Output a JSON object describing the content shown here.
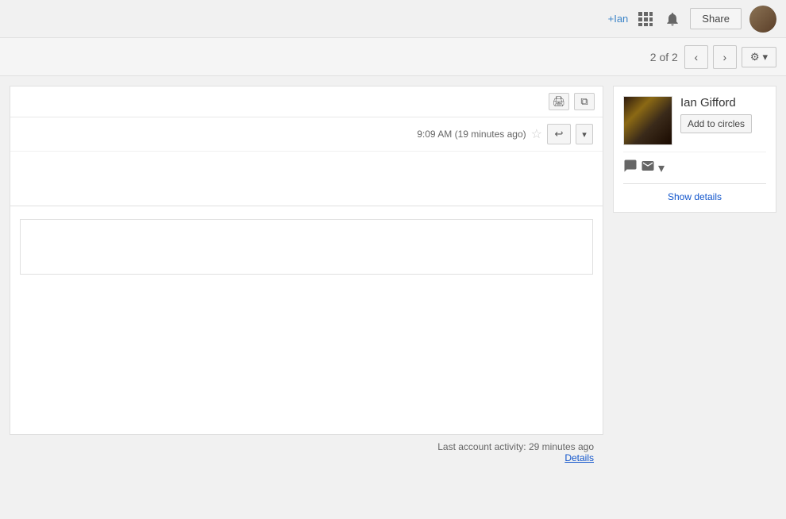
{
  "topnav": {
    "plus_ian_label": "+Ian",
    "share_label": "Share"
  },
  "toolbar": {
    "page_indicator": "2 of 2",
    "settings_label": "⚙"
  },
  "email": {
    "print_icon": "🖨",
    "image_icon": "🖼",
    "time": "9:09 AM (19 minutes ago)",
    "reply_icon": "↩",
    "more_icon": "▾"
  },
  "footer": {
    "activity": "Last account activity: 29 minutes ago",
    "details_label": "Details"
  },
  "contact": {
    "name": "Ian Gifford",
    "add_circles_label": "Add to circles",
    "show_details_label": "Show details",
    "chat_icon": "💬",
    "email_icon": "✉",
    "more_icon": "▾"
  }
}
